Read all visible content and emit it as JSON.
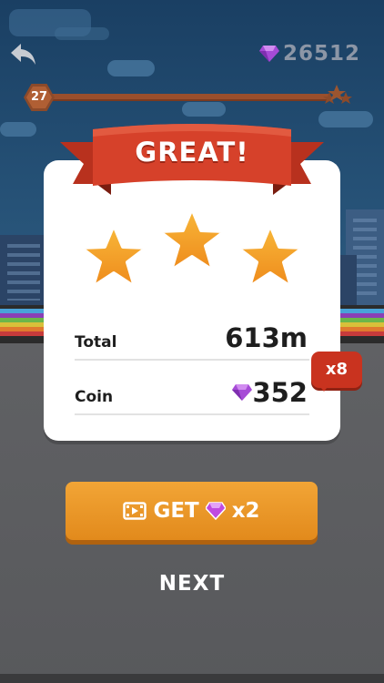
{
  "hud": {
    "gem_total": "26512",
    "level": "27"
  },
  "result": {
    "title": "GREAT!",
    "stars_earned": 3,
    "stars_total": 3,
    "total_label": "Total",
    "total_value": "613m",
    "coin_label": "Coin",
    "coin_value": "352",
    "multiplier_badge": "x8"
  },
  "actions": {
    "get_label": "GET",
    "get_multiplier": "x2",
    "next_label": "NEXT"
  },
  "icons": {
    "back": "back-arrow-icon",
    "gem": "purple-gem-icon",
    "video": "video-ad-icon",
    "star": "star-icon"
  },
  "colors": {
    "ribbon": "#d6412a",
    "star": "#f2a12a",
    "button": "#eb9a2b",
    "badge": "#c9331f",
    "gem": "#a64bd6"
  }
}
